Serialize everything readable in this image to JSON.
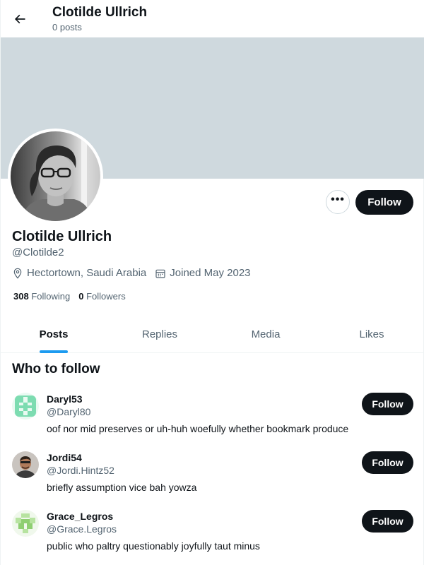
{
  "header": {
    "name": "Clotilde Ullrich",
    "posts": "0 posts",
    "back_icon": "arrow-left-icon"
  },
  "profile": {
    "name": "Clotilde Ullrich",
    "handle": "@Clotilde2",
    "location": "Hectortown, Saudi Arabia",
    "joined": "Joined May 2023",
    "following_count": "308",
    "following_label": "Following",
    "followers_count": "0",
    "followers_label": "Followers",
    "follow_label": "Follow",
    "more_label": "•••",
    "banner_color": "#cfd9de"
  },
  "tabs": [
    {
      "label": "Posts",
      "active": true
    },
    {
      "label": "Replies",
      "active": false
    },
    {
      "label": "Media",
      "active": false
    },
    {
      "label": "Likes",
      "active": false
    }
  ],
  "who_to_follow": {
    "title": "Who to follow",
    "users": [
      {
        "name": "Daryl53",
        "handle": "@Daryl80",
        "bio": "oof nor mid preserves or uh-huh woefully whether bookmark produce",
        "follow_label": "Follow"
      },
      {
        "name": "Jordi54",
        "handle": "@Jordi.Hintz52",
        "bio": "briefly assumption vice bah yowza",
        "follow_label": "Follow"
      },
      {
        "name": "Grace_Legros",
        "handle": "@Grace.Legros",
        "bio": "public who paltry questionably joyfully taut minus",
        "follow_label": "Follow"
      }
    ]
  },
  "colors": {
    "accent": "#1d9bf0",
    "text": "#0f1419",
    "secondary": "#536471",
    "button_bg": "#0f1419"
  }
}
